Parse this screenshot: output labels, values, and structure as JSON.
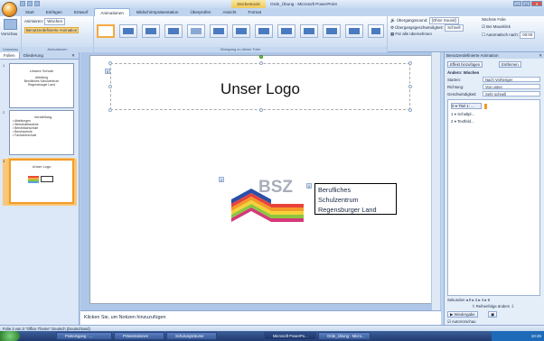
{
  "window": {
    "title": "Orde_Übung - Microsoft PowerPoint",
    "context_tab": "Zeichentools"
  },
  "tabs": [
    "Start",
    "Einfügen",
    "Entwurf",
    "Animationen",
    "Bildschirmpräsentation",
    "Überprüfen",
    "Ansicht",
    "Format"
  ],
  "active_tab": "Animationen",
  "ribbon": {
    "preview_label": "Vorschau",
    "animieren_label": "Animieren:",
    "animieren_value": "Wischen",
    "custom_anim_label": "Benutzerdefinierte Animation",
    "group_preview": "Vorschau",
    "group_animations": "Animationen",
    "group_transition": "Übergang zu dieser Folie",
    "sound_label": "Übergangssound:",
    "sound_value": "[Ohne Sound]",
    "speed_label": "Übergangsgeschwindigkeit:",
    "speed_value": "Schnell",
    "apply_all_label": "Für alle übernehmen",
    "next_slide_label": "Nächste Folie",
    "on_click_label": "Bei Mausklick",
    "auto_after_label": "Automatisch nach:",
    "auto_after_value": "00:00"
  },
  "left_pane": {
    "tabs": [
      "Folien",
      "Gliederung"
    ],
    "slides": [
      {
        "num": "1",
        "lines": [
          "Unsere Schule",
          "Abteilung",
          "Berufliches Schulzentrum",
          "Regensburger Land"
        ]
      },
      {
        "num": "2",
        "lines": [
          "Vorstellung",
          "• Abteilungen",
          "• Wirtschaftsschule",
          "• Berufsfachschule",
          "• Berufsschule",
          "• Fachoberschule"
        ]
      },
      {
        "num": "3",
        "lines": [
          "Unser Logo"
        ]
      }
    ]
  },
  "slide": {
    "title": "Unser Logo",
    "textbox_lines": [
      "Berufliches",
      "Schulzentrum",
      "Regensburger Land"
    ],
    "logo_text": "BSZ",
    "marker_title": "0",
    "marker_logo": "1",
    "marker_text": "2"
  },
  "notes_placeholder": "Klicken Sie, um Notizen hinzuzufügen",
  "right_pane": {
    "title": "Benutzerdefinierte Animation",
    "add_effect": "Effekt hinzufügen",
    "remove": "Entfernen",
    "change_label": "Ändern: Wischen",
    "start_label": "Starten:",
    "start_value": "Nach Vorheriger",
    "direction_label": "Richtung:",
    "direction_value": "Von unten",
    "speed_label": "Geschwindigkeit:",
    "speed_value": "Sehr schnell",
    "animations": [
      {
        "num": "0",
        "label": "Titel 1: ..."
      },
      {
        "num": "1",
        "label": "Schaltpl..."
      },
      {
        "num": "2",
        "label": "Textfeld..."
      }
    ],
    "order_label": "Reihenfolge ändern",
    "play_label": "Wiedergabe",
    "slideshow_label": "Bildschirmpräs.",
    "autopreview_label": "AutoVorschau",
    "seconds_label": "Sekunden"
  },
  "status": {
    "text": "Folie 3 von 3   \"Office Theme\"   Deutsch (Deutschland)"
  },
  "taskbar": {
    "items": [
      "Start",
      "Posteingang - ...",
      "Präsentationen",
      "Schulungsräume",
      "Microsoft PowerPo...",
      "Orde_Übung - Micro..."
    ],
    "clock": "10:45"
  },
  "colors": {
    "accent": "#f4a940",
    "ribbon_blue": "#c5d9f1",
    "selection": "#f39b2a"
  }
}
